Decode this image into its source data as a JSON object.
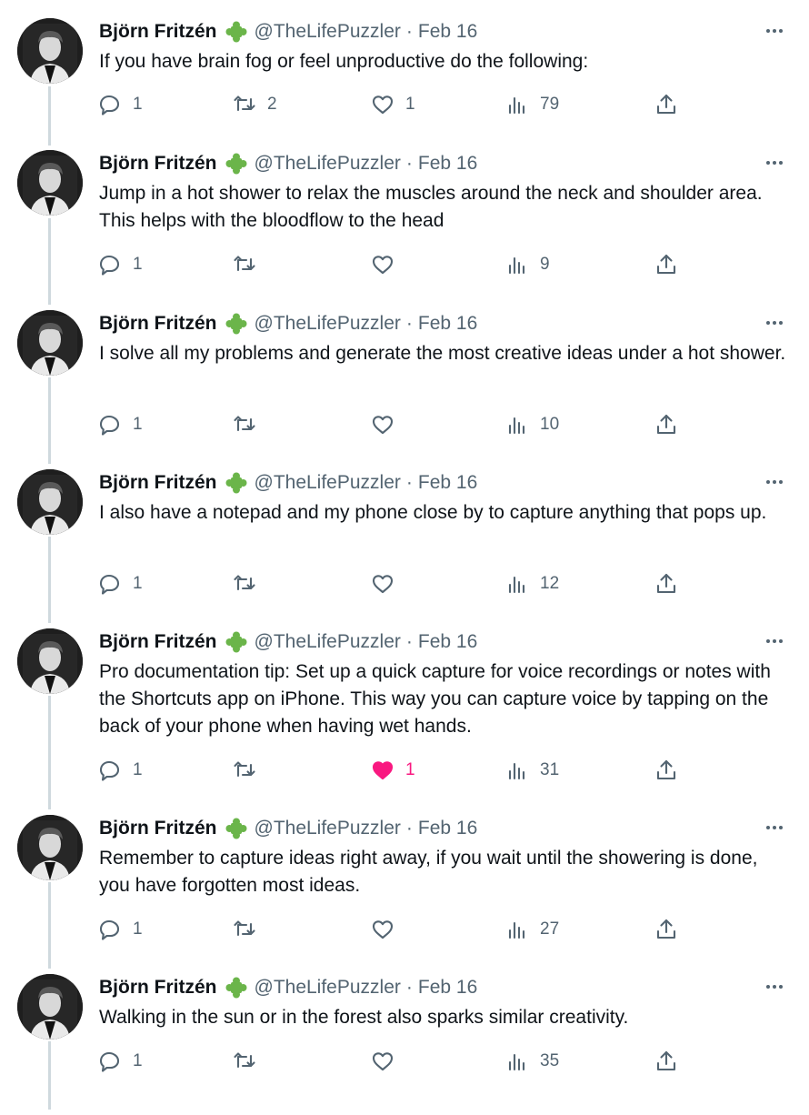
{
  "author": {
    "name": "Björn Fritzén",
    "handle": "@TheLifePuzzler",
    "separator": "·",
    "badge_icon": "green-puzzle-piece-icon",
    "badge_color": "#6bb54a"
  },
  "colors": {
    "like": "#f91880",
    "muted": "#536471",
    "thread_line": "#cfd9de"
  },
  "tweets": [
    {
      "date": "Feb 16",
      "text": "If you have brain fog or feel unproductive do the following:",
      "replies": "1",
      "retweets": "2",
      "likes": "1",
      "views": "79",
      "liked": false
    },
    {
      "date": "Feb 16",
      "text": "Jump in a hot shower to relax the muscles around the neck and shoulder area. This helps with the bloodflow to the head",
      "replies": "1",
      "retweets": "",
      "likes": "",
      "views": "9",
      "liked": false
    },
    {
      "date": "Feb 16",
      "text": "I solve all my problems and generate the most creative ideas under a hot shower.",
      "replies": "1",
      "retweets": "",
      "likes": "",
      "views": "10",
      "liked": false
    },
    {
      "date": "Feb 16",
      "text": "I also have a notepad and my phone close by to capture anything that pops up.",
      "replies": "1",
      "retweets": "",
      "likes": "",
      "views": "12",
      "liked": false
    },
    {
      "date": "Feb 16",
      "text": "Pro documentation tip: Set up a quick capture for voice recordings or notes with the Shortcuts app on iPhone. This way you can capture voice by tapping on the back of your phone when having wet hands.",
      "replies": "1",
      "retweets": "",
      "likes": "1",
      "views": "31",
      "liked": true
    },
    {
      "date": "Feb 16",
      "text": "Remember to capture ideas right away, if you wait until the showering is done, you have forgotten most ideas.",
      "replies": "1",
      "retweets": "",
      "likes": "",
      "views": "27",
      "liked": false
    },
    {
      "date": "Feb 16",
      "text": "Walking in the sun or in the forest also sparks similar creativity.",
      "replies": "1",
      "retweets": "",
      "likes": "",
      "views": "35",
      "liked": false
    }
  ]
}
